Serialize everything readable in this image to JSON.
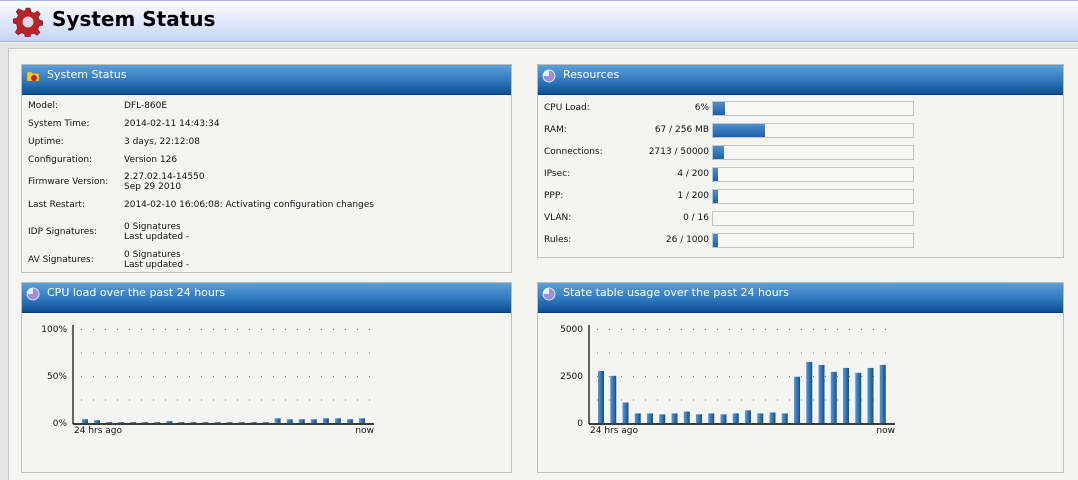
{
  "page_title": "System Status",
  "system_status": {
    "title": "System Status",
    "rows": [
      {
        "label": "Model:",
        "value": "DFL-860E"
      },
      {
        "label": "System Time:",
        "value": "2014-02-11 14:43:34"
      },
      {
        "label": "Uptime:",
        "value": "3 days, 22:12:08"
      },
      {
        "label": "Configuration:",
        "value": "Version 126"
      },
      {
        "label": "Firmware Version:",
        "value": "2.27.02.14-14550",
        "value2": "Sep 29 2010"
      },
      {
        "label": "Last Restart:",
        "value": "2014-02-10 16:06:08: Activating configuration changes"
      },
      {
        "label": "IDP Signatures:",
        "value": "0 Signatures",
        "value2": "Last updated -"
      },
      {
        "label": "AV Signatures:",
        "value": "0 Signatures",
        "value2": "Last updated -"
      }
    ]
  },
  "resources": {
    "title": "Resources",
    "rows": [
      {
        "label": "CPU Load:",
        "value": "6%",
        "fraction": 0.06
      },
      {
        "label": "RAM:",
        "value": "67 / 256 MB",
        "fraction": 0.262
      },
      {
        "label": "Connections:",
        "value": "2713 / 50000",
        "fraction": 0.054
      },
      {
        "label": "IPsec:",
        "value": "4 / 200",
        "fraction": 0.02
      },
      {
        "label": "PPP:",
        "value": "1 / 200",
        "fraction": 0.005
      },
      {
        "label": "VLAN:",
        "value": "0 / 16",
        "fraction": 0
      },
      {
        "label": "Rules:",
        "value": "26 / 1000",
        "fraction": 0.026
      }
    ]
  },
  "chart_data": [
    {
      "type": "bar",
      "title": "CPU load over the past 24 hours",
      "ylim": [
        0,
        100
      ],
      "yticks": [
        "0%",
        "50%",
        "100%"
      ],
      "ytick_values": [
        0,
        50,
        100
      ],
      "xlabels": [
        "24 hrs ago",
        "now"
      ],
      "values": [
        4,
        3,
        1,
        1,
        1,
        1,
        1,
        2,
        1,
        1,
        1,
        1,
        1,
        1,
        1,
        1,
        5,
        4,
        4,
        4,
        5,
        5,
        4,
        5
      ]
    },
    {
      "type": "bar",
      "title": "State table usage over the past 24 hours",
      "ylim": [
        0,
        5000
      ],
      "yticks": [
        "0",
        "2500",
        "5000"
      ],
      "ytick_values": [
        0,
        2500,
        5000
      ],
      "xlabels": [
        "24 hrs ago",
        "now"
      ],
      "values": [
        2770,
        2510,
        1090,
        510,
        510,
        460,
        510,
        610,
        460,
        510,
        460,
        510,
        670,
        510,
        560,
        510,
        2460,
        3250,
        3090,
        2720,
        2930,
        2670,
        2930,
        3090
      ]
    }
  ],
  "colors": {
    "header_blue": "#2f78be",
    "bar_blue": "#1d60a8",
    "gear_red": "#b8232a"
  }
}
